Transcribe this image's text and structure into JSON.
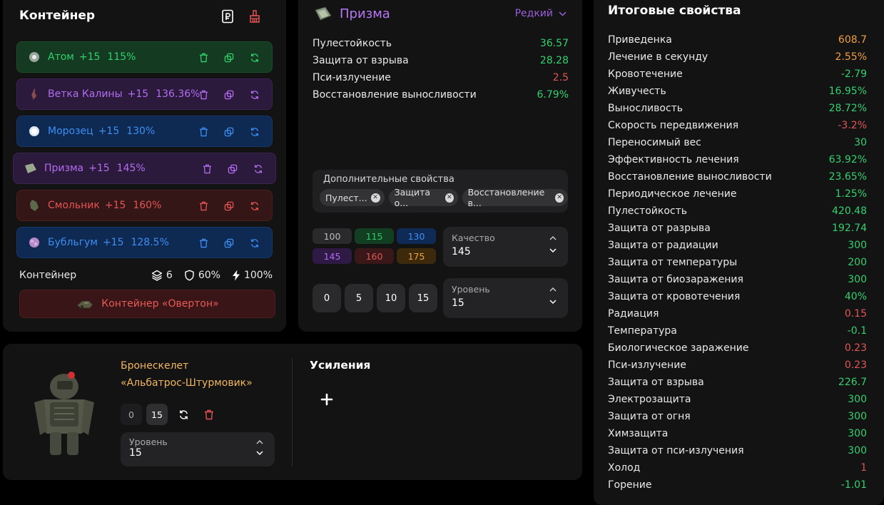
{
  "container": {
    "title": "Контейнер",
    "artifacts": [
      {
        "name": "Атом",
        "level": "+15",
        "quality": "115%",
        "color": "green"
      },
      {
        "name": "Ветка Калины",
        "level": "+15",
        "quality": "136.36%",
        "color": "purple"
      },
      {
        "name": "Морозец",
        "level": "+15",
        "quality": "130%",
        "color": "blue"
      },
      {
        "name": "Призма",
        "level": "+15",
        "quality": "145%",
        "color": "purple"
      },
      {
        "name": "Смольник",
        "level": "+15",
        "quality": "160%",
        "color": "red"
      },
      {
        "name": "Бубльгум",
        "level": "+15",
        "quality": "128.5%",
        "color": "blue"
      }
    ],
    "stats_label": "Контейнер",
    "slots": "6",
    "protection": "60%",
    "energy": "100%",
    "container_button": "Контейнер «Овертон»"
  },
  "detail": {
    "title": "Призма",
    "rarity": "Редкий",
    "properties": [
      {
        "name": "Пулестойкость",
        "value": "36.57",
        "tone": "green"
      },
      {
        "name": "Защита от взрыва",
        "value": "28.28",
        "tone": "green"
      },
      {
        "name": "Пси-излучение",
        "value": "2.5",
        "tone": "red"
      },
      {
        "name": "Восстановление выносливости",
        "value": "6.79%",
        "tone": "green"
      }
    ],
    "extra_label": "Дополнительные свойства",
    "extra_chips": [
      "Пулест...",
      "Защита о...",
      "Восстановление в..."
    ],
    "quality_buttons": [
      "100",
      "115",
      "130",
      "145",
      "160",
      "175"
    ],
    "quality_select": {
      "label": "Качество",
      "value": "145"
    },
    "level_buttons": [
      "0",
      "5",
      "10",
      "15"
    ],
    "level_select": {
      "label": "Уровень",
      "value": "15"
    }
  },
  "armor": {
    "name_line1": "Бронескелет",
    "name_line2": "«Альбатрос-Штурмовик»",
    "level_buttons": [
      "0",
      "15"
    ],
    "level_select": {
      "label": "Уровень",
      "value": "15"
    },
    "boosts_title": "Усиления"
  },
  "totals": {
    "title": "Итоговые свойства",
    "rows": [
      {
        "name": "Приведенка",
        "value": "608.7",
        "tone": "orange"
      },
      {
        "name": "Лечение в секунду",
        "value": "2.55%",
        "tone": "orange"
      },
      {
        "name": "Кровотечение",
        "value": "-2.79",
        "tone": "green"
      },
      {
        "name": "Живучесть",
        "value": "16.95%",
        "tone": "green"
      },
      {
        "name": "Выносливость",
        "value": "28.72%",
        "tone": "green"
      },
      {
        "name": "Скорость передвижения",
        "value": "-3.2%",
        "tone": "red"
      },
      {
        "name": "Переносимый вес",
        "value": "30",
        "tone": "green"
      },
      {
        "name": "Эффективность лечения",
        "value": "63.92%",
        "tone": "green"
      },
      {
        "name": "Восстановление выносливости",
        "value": "23.65%",
        "tone": "green"
      },
      {
        "name": "Периодическое лечение",
        "value": "1.25%",
        "tone": "green"
      },
      {
        "name": "Пулестойкость",
        "value": "420.48",
        "tone": "green"
      },
      {
        "name": "Защита от разрыва",
        "value": "192.74",
        "tone": "green"
      },
      {
        "name": "Защита от радиации",
        "value": "300",
        "tone": "green"
      },
      {
        "name": "Защита от температуры",
        "value": "200",
        "tone": "green"
      },
      {
        "name": "Защита от биозаражения",
        "value": "300",
        "tone": "green"
      },
      {
        "name": "Защита от кровотечения",
        "value": "40%",
        "tone": "green"
      },
      {
        "name": "Радиация",
        "value": "0.15",
        "tone": "red"
      },
      {
        "name": "Температура",
        "value": "-0.1",
        "tone": "green"
      },
      {
        "name": "Биологическое заражение",
        "value": "0.23",
        "tone": "red"
      },
      {
        "name": "Пси-излучение",
        "value": "0.23",
        "tone": "red"
      },
      {
        "name": "Защита от взрыва",
        "value": "226.7",
        "tone": "green"
      },
      {
        "name": "Электрозащита",
        "value": "300",
        "tone": "green"
      },
      {
        "name": "Защита от огня",
        "value": "300",
        "tone": "green"
      },
      {
        "name": "Химзащита",
        "value": "300",
        "tone": "green"
      },
      {
        "name": "Защита от пси-излучения",
        "value": "300",
        "tone": "green"
      },
      {
        "name": "Холод",
        "value": "1",
        "tone": "red"
      },
      {
        "name": "Горение",
        "value": "-1.01",
        "tone": "green"
      }
    ]
  },
  "icons": {
    "header": [
      "ruble-document-icon",
      "broom-icon"
    ],
    "artifact_actions": [
      "trash-icon",
      "copy-icon",
      "refresh-icon"
    ],
    "stats": [
      "layers-icon",
      "shield-icon",
      "bolt-icon"
    ]
  },
  "colors": {
    "green": "#2fd26b",
    "purple": "#b16cf0",
    "blue": "#3d8df3",
    "red": "#e55353",
    "orange": "#f0a040",
    "armor_name": "#f2b660"
  }
}
